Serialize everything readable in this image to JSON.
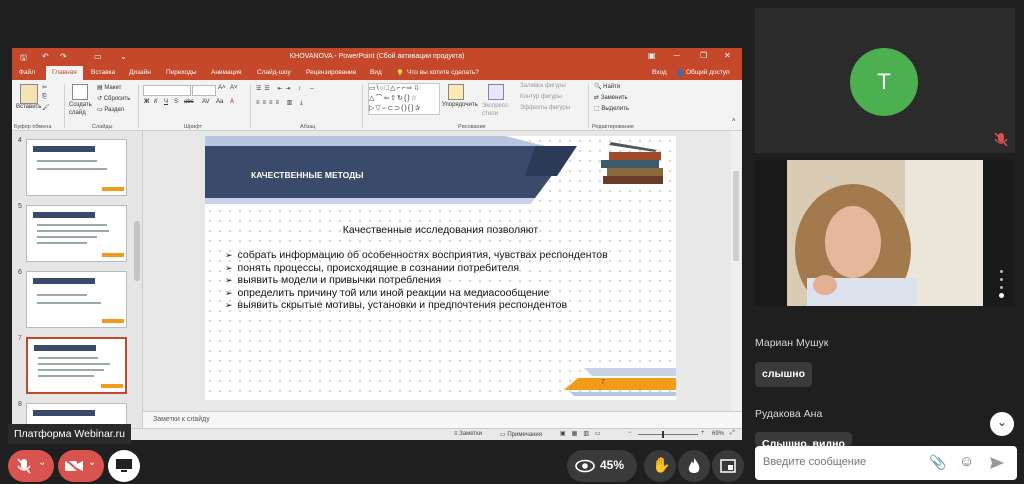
{
  "powerpoint": {
    "window_title": "KHOVANOVA - PowerPoint (Сбой активации продукта)",
    "menu": [
      "Файл",
      "Главная",
      "Вставка",
      "Дизайн",
      "Переходы",
      "Анимация",
      "Слайд-шоу",
      "Рецензирование",
      "Вид"
    ],
    "active_menu": "Главная",
    "tell_me": "Что вы хотите сделать?",
    "login": "Вход",
    "share": "Общий доступ",
    "ribbon": {
      "paste": "Вставить",
      "create_slide": "Создать слайд",
      "layout": "Макет",
      "reset": "Сбросить",
      "section": "Раздел",
      "arrange": "Упорядочить",
      "quick_styles": "Экспресс-стили",
      "shape_fill": "Заливка фигуры",
      "shape_outline": "Контур фигуры",
      "shape_effects": "Эффекты фигуры",
      "find": "Найти",
      "replace": "Заменить",
      "select": "Выделить",
      "groups": {
        "clipboard": "Буфер обмена",
        "slides": "Слайды",
        "font": "Шрифт",
        "paragraph": "Абзац",
        "drawing": "Рисование",
        "editing": "Редактирование"
      }
    },
    "thumbnails": [
      {
        "num": "4"
      },
      {
        "num": "5"
      },
      {
        "num": "6"
      },
      {
        "num": "7"
      },
      {
        "num": "8"
      }
    ],
    "slide": {
      "title": "КАЧЕСТВЕННЫЕ МЕТОДЫ",
      "heading": "Качественные исследования позволяют",
      "bullets": [
        "собрать информацию об особенностях восприятия, чувствах респондентов",
        "понять процессы, происходящие в сознании потребителя",
        "выявить модели и привычки потребления",
        "определить причину той или иной реакции на медиасообщение",
        "выявить скрытые мотивы, установки и предпочтения респондентов"
      ],
      "number": "7"
    },
    "notes_placeholder": "Заметки к слайду",
    "status": {
      "notes": "Заметки",
      "comments": "Примечания",
      "zoom": "69%"
    }
  },
  "webinar": {
    "brand": "Платформа Webinar.ru",
    "viewers": "45%",
    "participant_initial": "T",
    "chat": [
      {
        "name": "Мариан Мушук",
        "message": "слышно"
      },
      {
        "name": "Рудакова Ана",
        "message": "Слышно, видно"
      }
    ],
    "input_placeholder": "Введите сообщение"
  },
  "colors": {
    "ppt_accent": "#c5482a",
    "slide_navy": "#3a4a6b",
    "slide_orange": "#f29a1a",
    "avatar": "#4caf50",
    "mic_off": "#d9534f"
  }
}
